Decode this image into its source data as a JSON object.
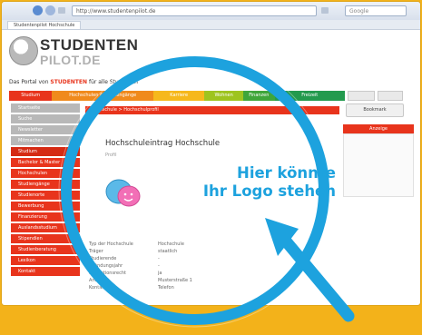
{
  "browser": {
    "address": "http://www.studentenpilot.de",
    "search_placeholder": "Google",
    "tab_title": "Studentenpilot Hochschule"
  },
  "site": {
    "logo_line1": "STUDENTEN",
    "logo_line2": "PILOT.DE",
    "tagline_prefix": "Das Portal von",
    "tagline_highlight": "STUDENTEN",
    "tagline_suffix": "für alle Studenten"
  },
  "menu": {
    "items": [
      {
        "label": "Studium",
        "color": "#e8341c",
        "flex": 1.1
      },
      {
        "label": "Hochschulen & Studiengänge",
        "color": "#f08a1c",
        "flex": 2.6
      },
      {
        "label": "Karriere",
        "color": "#f6b81c",
        "flex": 1.3
      },
      {
        "label": "Wohnen",
        "color": "#9ec41f",
        "flex": 1.0
      },
      {
        "label": "Finanzen",
        "color": "#3fa63a",
        "flex": 0.8
      },
      {
        "label": "Freizeit",
        "color": "#239a4e",
        "flex": 1.8
      }
    ]
  },
  "content": {
    "bar_text": "Hochschule > Hochschulprofil",
    "bookmark_label": "Bookmark",
    "right_panel_label": "Anzeige",
    "page_title": "Hochschuleintrag Hochschule",
    "subline": "Profil",
    "details": [
      {
        "label": "Typ der Hochschule",
        "value": "Hochschule"
      },
      {
        "label": "Träger",
        "value": "staatlich"
      },
      {
        "label": "Studierende",
        "value": "-"
      },
      {
        "label": "Gründungsjahr",
        "value": "-"
      },
      {
        "label": "Promotionsrecht",
        "value": "ja"
      },
      {
        "label": "Anschrift",
        "value": "Musterstraße 1"
      },
      {
        "label": "Kontakt",
        "value": "Telefon"
      }
    ]
  },
  "sidebar": {
    "items": [
      {
        "label": "Startseite",
        "style": "grey"
      },
      {
        "label": "Suche",
        "style": "grey"
      },
      {
        "label": "Newsletter",
        "style": "grey"
      },
      {
        "label": "Mitmachen",
        "style": "grey"
      },
      {
        "label": "Studium",
        "style": "red-head"
      },
      {
        "label": "Bachelor & Master",
        "style": "red"
      },
      {
        "label": "Hochschulen",
        "style": "red"
      },
      {
        "label": "Studiengänge",
        "style": "red"
      },
      {
        "label": "Studienorte",
        "style": "red"
      },
      {
        "label": "Bewerbung",
        "style": "red"
      },
      {
        "label": "Finanzierung",
        "style": "red"
      },
      {
        "label": "Auslandsstudium",
        "style": "red"
      },
      {
        "label": "Stipendien",
        "style": "red"
      },
      {
        "label": "Studienberatung",
        "style": "red"
      },
      {
        "label": "Lexikon",
        "style": "red"
      },
      {
        "label": "Kontakt",
        "style": "red"
      }
    ]
  },
  "ad": {
    "line1": "Hier könnte",
    "line2": "Ihr Logo stehen",
    "ring_color": "#1da2de"
  }
}
